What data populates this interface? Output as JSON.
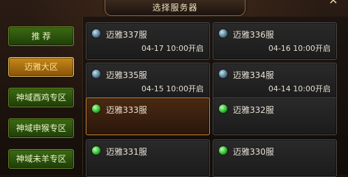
{
  "title": "选择服务器",
  "close_symbol": "✕",
  "tabs": [
    {
      "label": "推 荐",
      "active": false
    },
    {
      "label": "迈雅大区",
      "active": true
    },
    {
      "label": "神域酉鸡专区",
      "active": false
    },
    {
      "label": "神域申猴专区",
      "active": false
    },
    {
      "label": "神域未羊专区",
      "active": false
    }
  ],
  "servers": [
    {
      "name": "迈雅337服",
      "time": "04-17 10:00开启",
      "status": "blue",
      "selected": false
    },
    {
      "name": "迈雅336服",
      "time": "04-16 10:00开启",
      "status": "blue",
      "selected": false
    },
    {
      "name": "迈雅335服",
      "time": "04-15 10:00开启",
      "status": "blue",
      "selected": false
    },
    {
      "name": "迈雅334服",
      "time": "04-14 10:00开启",
      "status": "blue",
      "selected": false
    },
    {
      "name": "迈雅333服",
      "time": "",
      "status": "green",
      "selected": true
    },
    {
      "name": "迈雅332服",
      "time": "",
      "status": "green",
      "selected": false
    },
    {
      "name": "迈雅331服",
      "time": "",
      "status": "green",
      "selected": false
    },
    {
      "name": "迈雅330服",
      "time": "",
      "status": "green",
      "selected": false
    }
  ]
}
